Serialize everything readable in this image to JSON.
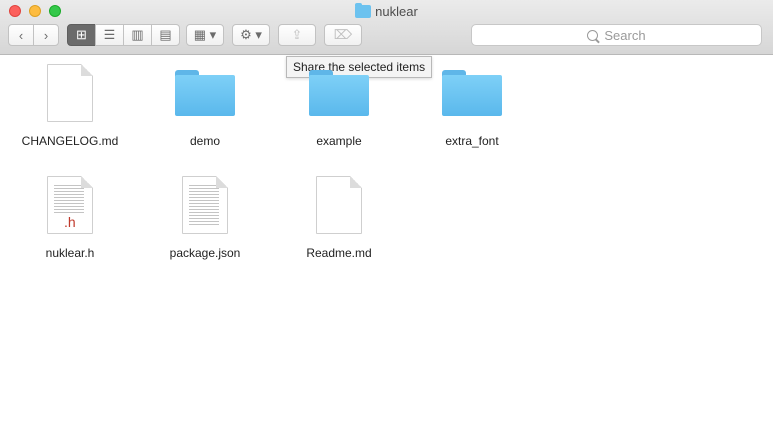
{
  "window": {
    "title": "nuklear"
  },
  "toolbar": {
    "back_label": "‹",
    "forward_label": "›",
    "view_icon_label": "⊞",
    "view_list_label": "☰",
    "view_column_label": "▥",
    "view_cover_label": "▤",
    "arrange_label": "▦ ▾",
    "action_label": "⚙ ▾",
    "share_label": "⇪",
    "tags_label": "⌦"
  },
  "search": {
    "placeholder": "Search"
  },
  "tooltip": {
    "text": "Share the selected items"
  },
  "items": [
    {
      "name": "CHANGELOG.md",
      "type": "document"
    },
    {
      "name": "demo",
      "type": "folder"
    },
    {
      "name": "example",
      "type": "folder"
    },
    {
      "name": "extra_font",
      "type": "folder"
    },
    {
      "name": "nuklear.h",
      "type": "source-h"
    },
    {
      "name": "package.json",
      "type": "text-preview"
    },
    {
      "name": "Readme.md",
      "type": "document"
    }
  ],
  "colors": {
    "folder": "#6cc2ef",
    "h_tag": "#c0392b",
    "accent_dark": "#6b6b6b"
  }
}
